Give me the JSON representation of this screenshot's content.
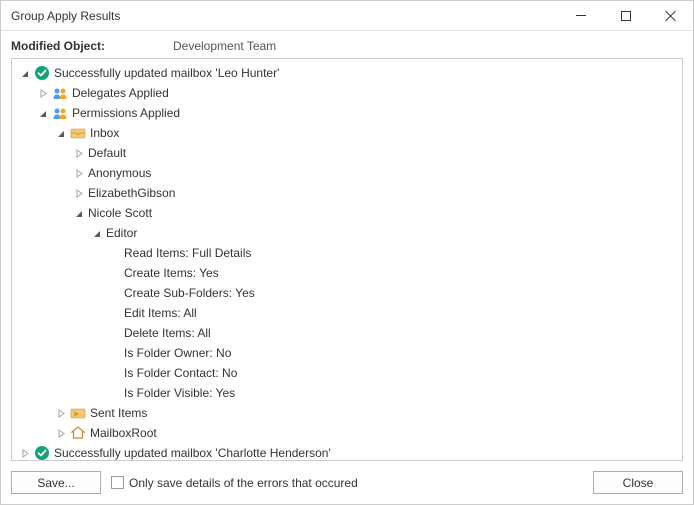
{
  "window": {
    "title": "Group Apply Results"
  },
  "header": {
    "label": "Modified Object:",
    "value": "Development Team"
  },
  "tree": {
    "root": {
      "label": "Successfully updated mailbox 'Leo Hunter'"
    },
    "delegates": {
      "label": "Delegates Applied"
    },
    "permissions": {
      "label": "Permissions Applied"
    },
    "inbox": {
      "label": "Inbox"
    },
    "default": {
      "label": "Default"
    },
    "anonymous": {
      "label": "Anonymous"
    },
    "elizabeth": {
      "label": "ElizabethGibson"
    },
    "nicole": {
      "label": "Nicole Scott"
    },
    "editor": {
      "label": "Editor"
    },
    "details": {
      "read": "Read Items: Full Details",
      "create": "Create Items: Yes",
      "subfolders": "Create Sub-Folders: Yes",
      "edit": "Edit Items: All",
      "delete": "Delete Items: All",
      "owner": "Is Folder Owner: No",
      "contact": "Is Folder Contact: No",
      "visible": "Is Folder Visible: Yes"
    },
    "sent": {
      "label": "Sent Items"
    },
    "mailboxroot": {
      "label": "MailboxRoot"
    },
    "nextroot": {
      "label": "Successfully updated mailbox 'Charlotte Henderson'"
    }
  },
  "footer": {
    "save": "Save...",
    "checkbox": "Only save details of the errors that occured",
    "close": "Close"
  }
}
